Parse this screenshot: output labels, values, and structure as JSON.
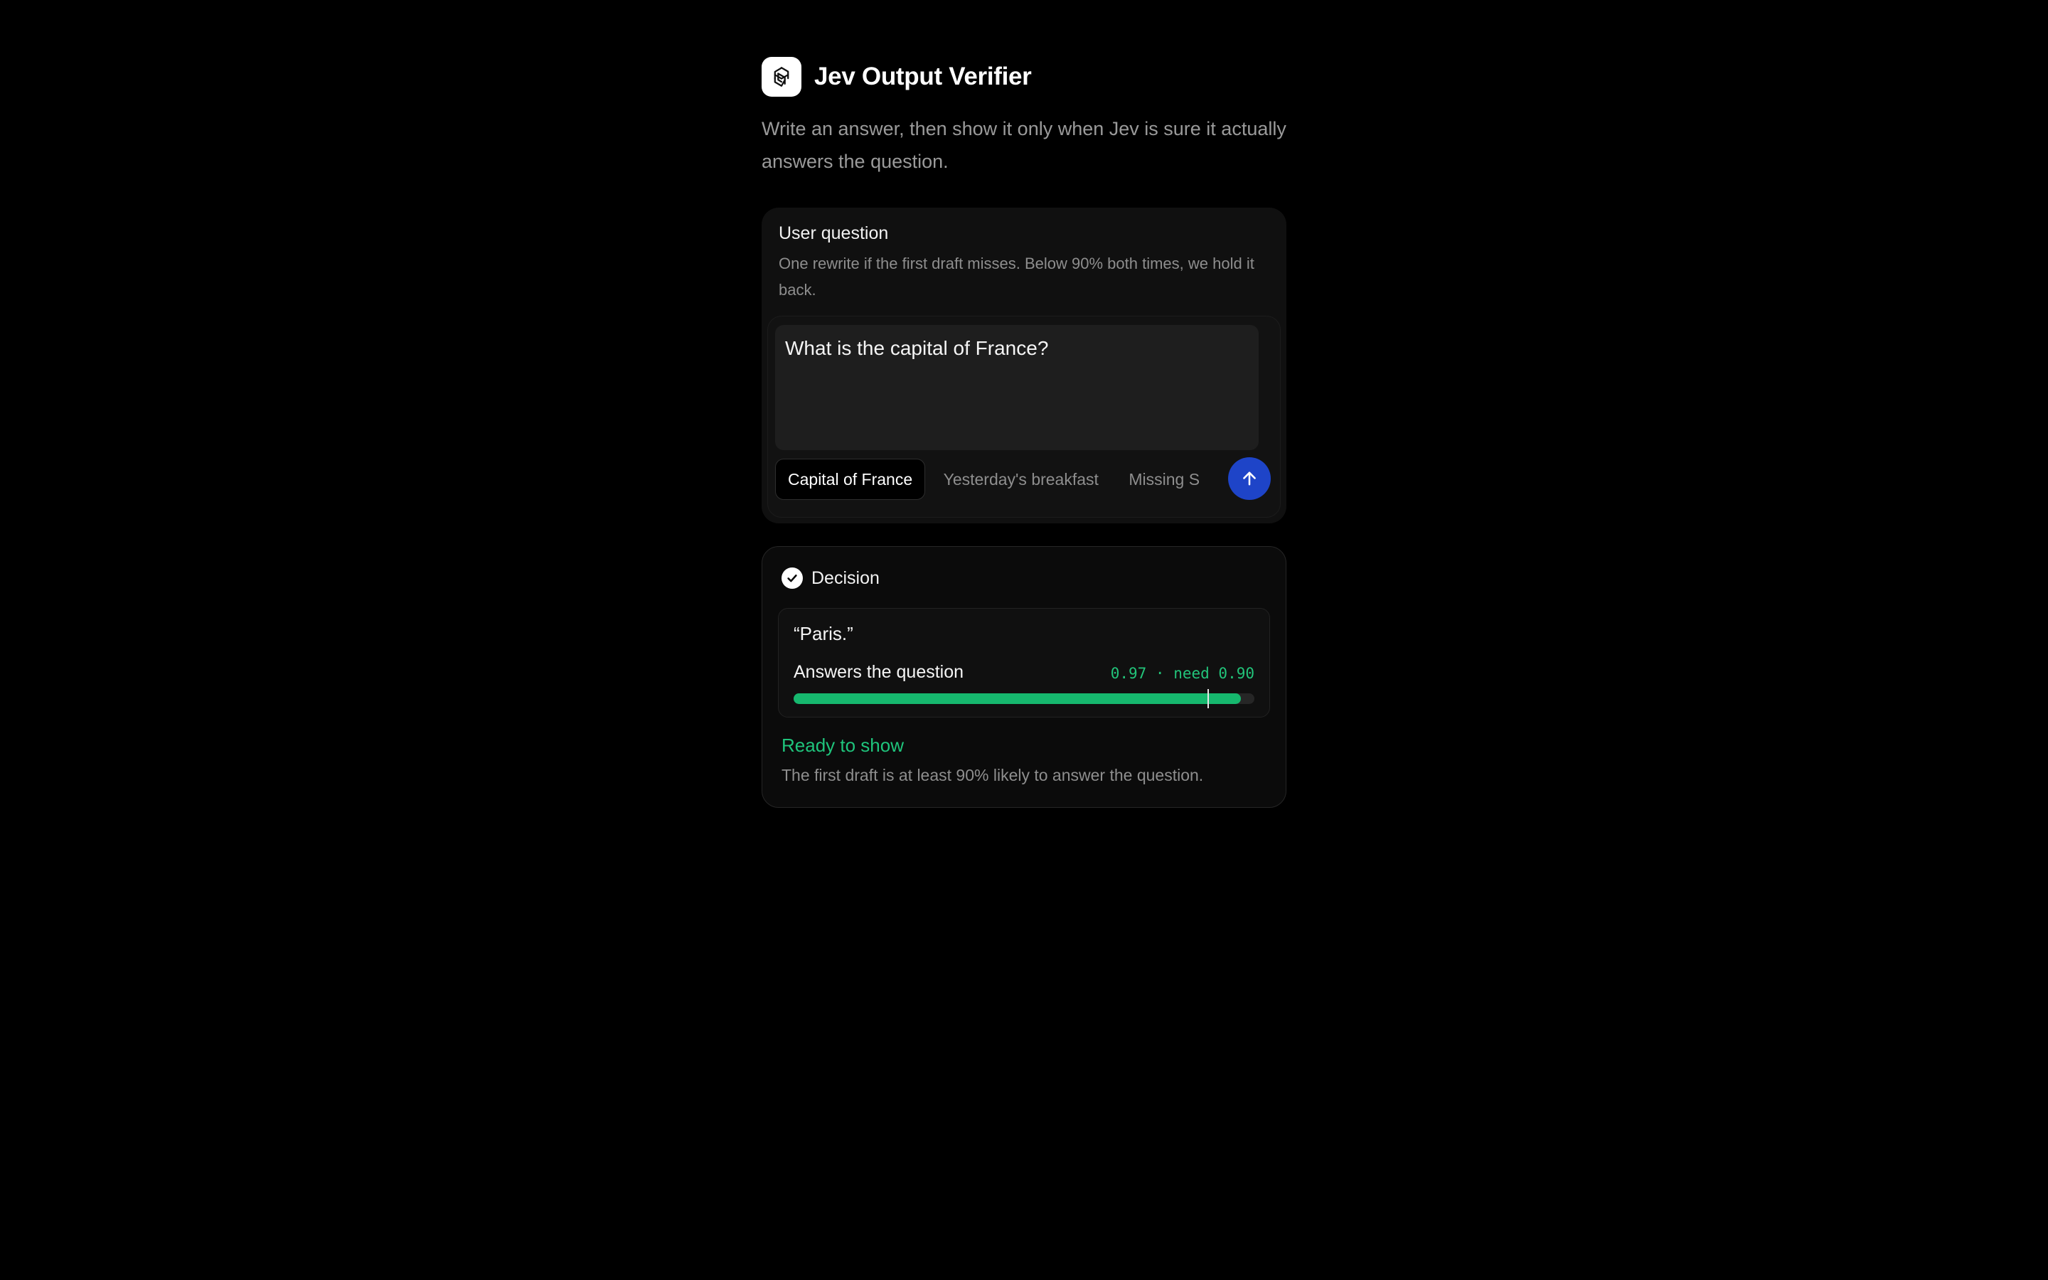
{
  "app": {
    "title": "Jev Output Verifier",
    "subtitle": "Write an answer, then show it only when Jev is sure it actually answers the question.",
    "logo_icon": "knot-logo-icon"
  },
  "question": {
    "title": "User question",
    "description": "One rewrite if the first draft misses. Below 90% both times, we hold it back.",
    "value": "What is the capital of France?",
    "presets": [
      {
        "label": "Capital of France",
        "active": true
      },
      {
        "label": "Yesterday's breakfast",
        "active": false
      },
      {
        "label": "Missing S",
        "active": false
      }
    ],
    "send_icon": "arrow-up-icon"
  },
  "decision": {
    "title": "Decision",
    "check_icon": "check-circle-icon",
    "answer": "“Paris.”",
    "metric_label": "Answers the question",
    "metric_value_text": "0.97 · need 0.90",
    "score": 0.97,
    "threshold": 0.9,
    "status_title": "Ready to show",
    "status_description": "The first draft is at least 90% likely to answer the question."
  },
  "colors": {
    "accent_blue": "#1e44c8",
    "success_green": "#16b86e",
    "background": "#000000"
  }
}
